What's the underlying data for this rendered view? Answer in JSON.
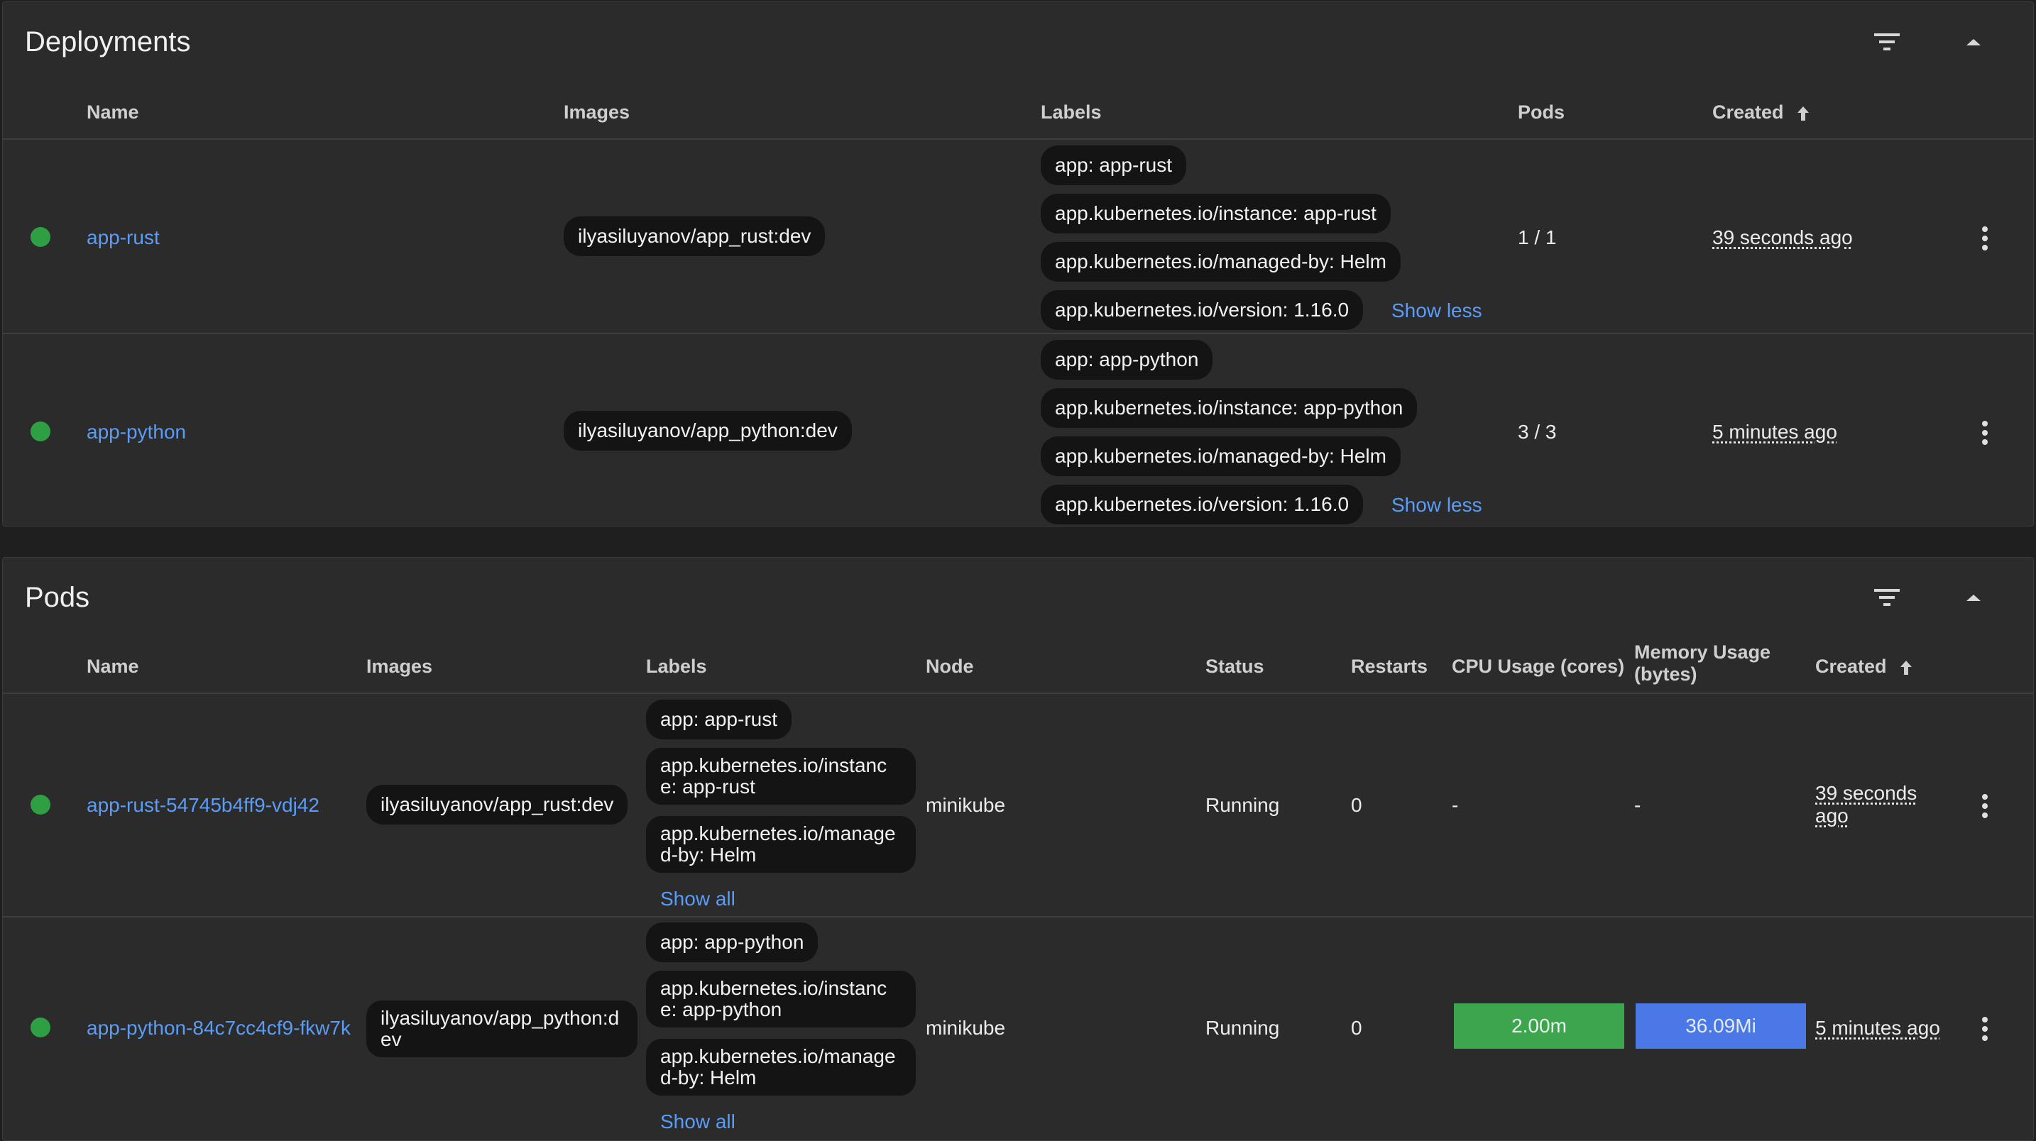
{
  "deployments": {
    "title": "Deployments",
    "columns": {
      "name": "Name",
      "images": "Images",
      "labels": "Labels",
      "pods": "Pods",
      "created": "Created"
    },
    "rows": [
      {
        "status": "running",
        "name": "app-rust",
        "image": "ilyasiluyanov/app_rust:dev",
        "labels": [
          "app: app-rust",
          "app.kubernetes.io/instance: app-rust",
          "app.kubernetes.io/managed-by: Helm",
          "app.kubernetes.io/version: 1.16.0"
        ],
        "labels_toggle": "Show less",
        "pods": "1 / 1",
        "created": "39 seconds ago"
      },
      {
        "status": "running",
        "name": "app-python",
        "image": "ilyasiluyanov/app_python:dev",
        "labels": [
          "app: app-python",
          "app.kubernetes.io/instance: app-python",
          "app.kubernetes.io/managed-by: Helm",
          "app.kubernetes.io/version: 1.16.0"
        ],
        "labels_toggle": "Show less",
        "pods": "3 / 3",
        "created": "5 minutes ago"
      }
    ]
  },
  "pods": {
    "title": "Pods",
    "columns": {
      "name": "Name",
      "images": "Images",
      "labels": "Labels",
      "node": "Node",
      "status": "Status",
      "restarts": "Restarts",
      "cpu": "CPU Usage (cores)",
      "memory": "Memory Usage (bytes)",
      "created": "Created"
    },
    "rows": [
      {
        "status_color": "#2ea043",
        "name": "app-rust-54745b4ff9-vdj42",
        "image": "ilyasiluyanov/app_rust:dev",
        "labels": [
          "app: app-rust",
          "app.kubernetes.io/instance: app-rust",
          "app.kubernetes.io/managed-by: Helm"
        ],
        "labels_toggle": "Show all",
        "node": "minikube",
        "status": "Running",
        "restarts": "0",
        "cpu": "-",
        "memory": "-",
        "created": "39 seconds ago"
      },
      {
        "status_color": "#2ea043",
        "name": "app-python-84c7cc4cf9-fkw7k",
        "image": "ilyasiluyanov/app_python:dev",
        "labels": [
          "app: app-python",
          "app.kubernetes.io/instance: app-python",
          "app.kubernetes.io/managed-by: Helm"
        ],
        "labels_toggle": "Show all",
        "node": "minikube",
        "status": "Running",
        "restarts": "0",
        "cpu": "2.00m",
        "memory": "36.09Mi",
        "created": "5 minutes ago"
      }
    ]
  },
  "icons": {
    "filter": "filter-icon",
    "collapse": "chevron-up-icon",
    "sort": "arrow-up-icon",
    "menu": "more-vert-icon"
  },
  "colors": {
    "link": "#5b9cf6",
    "status_ok": "#2ea043",
    "cpu_bar": "#3ea54f",
    "memory_bar": "#4a78e6"
  }
}
